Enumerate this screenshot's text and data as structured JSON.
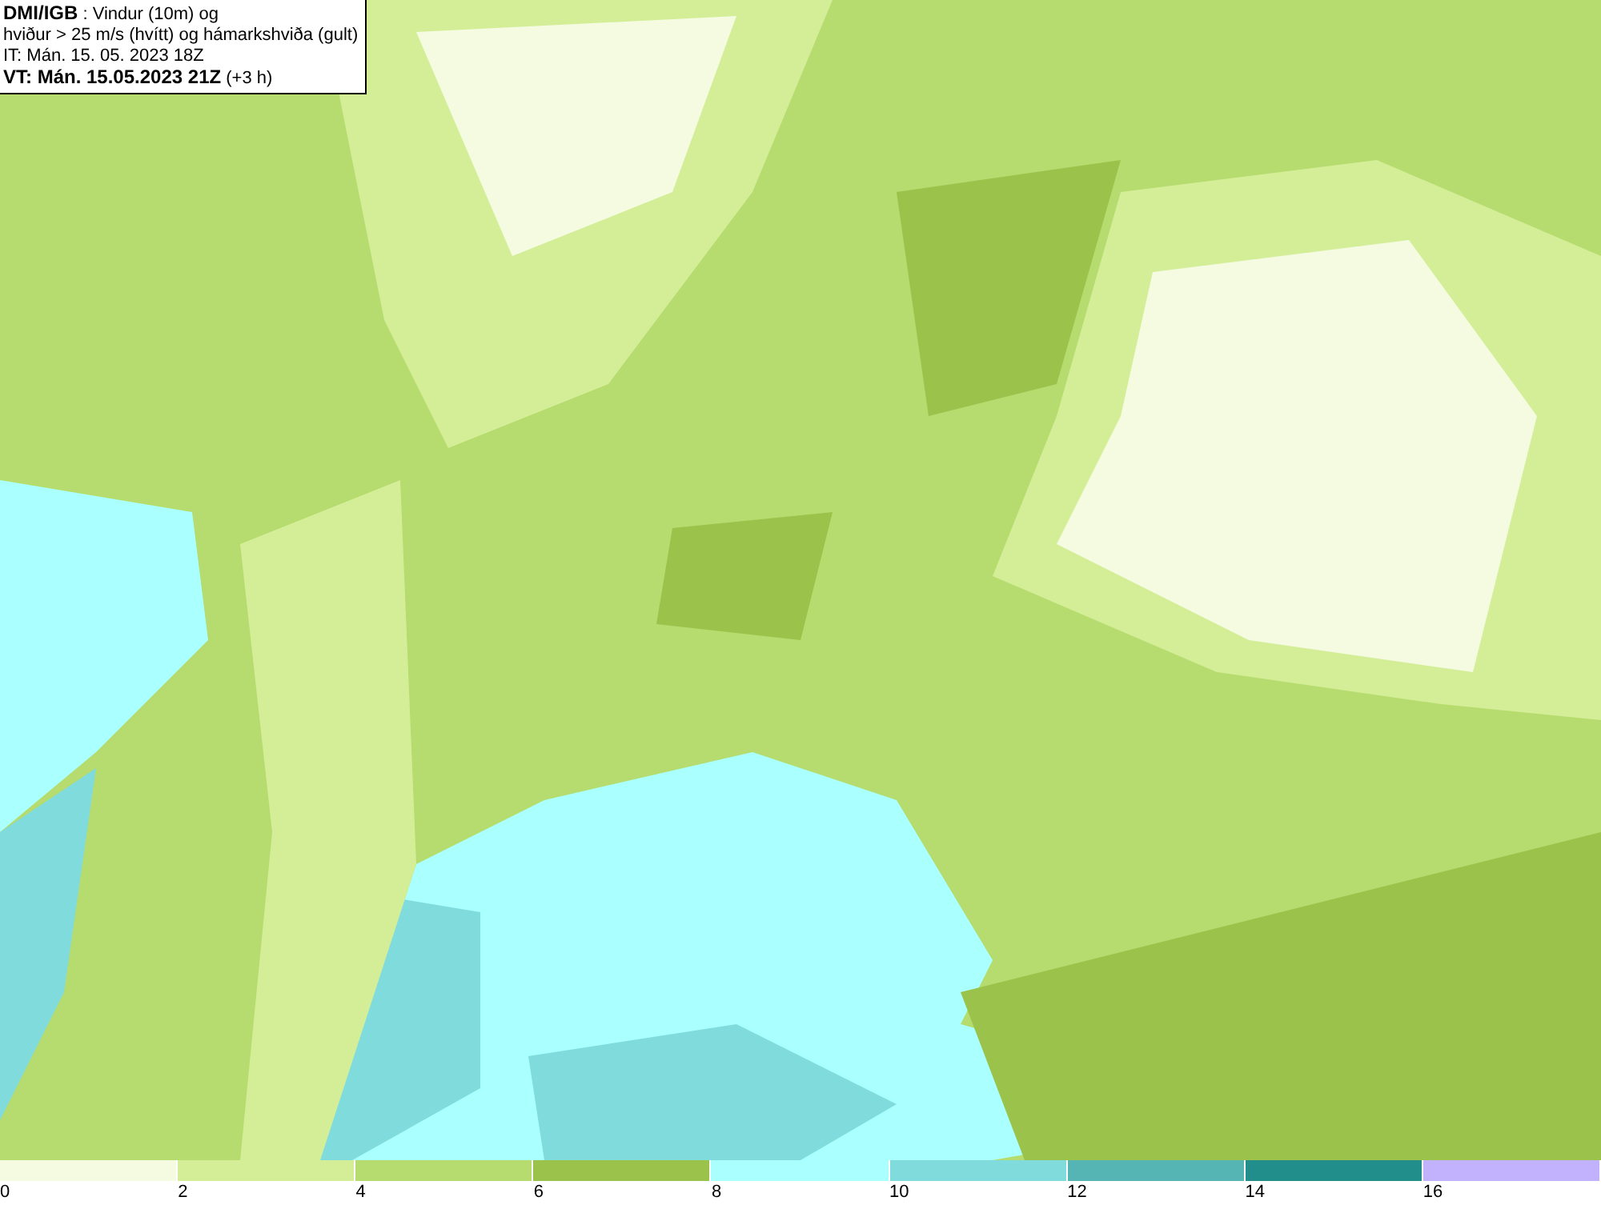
{
  "header": {
    "lines": [
      "**DMI/IGB** : Vindur (10m) og",
      "hviður > 25 m/s (hvítt) og hámarkshviða (gult)",
      "IT: Mán. 15. 05. 2023 18Z",
      "**VT: Mán. 15.05.2023 21Z** (+3 h)"
    ]
  },
  "legend": [
    {
      "label": "0",
      "color": "#f4fbe0"
    },
    {
      "label": "2",
      "color": "#d4ee98"
    },
    {
      "label": "4",
      "color": "#b6db6e"
    },
    {
      "label": "6",
      "color": "#9bc24a"
    },
    {
      "label": "8",
      "color": "#aaffff"
    },
    {
      "label": "10",
      "color": "#80dcdc"
    },
    {
      "label": "12",
      "color": "#55b4b4"
    },
    {
      "label": "14",
      "color": "#228e8c"
    },
    {
      "label": "16",
      "color": "#c2b2fe"
    }
  ]
}
